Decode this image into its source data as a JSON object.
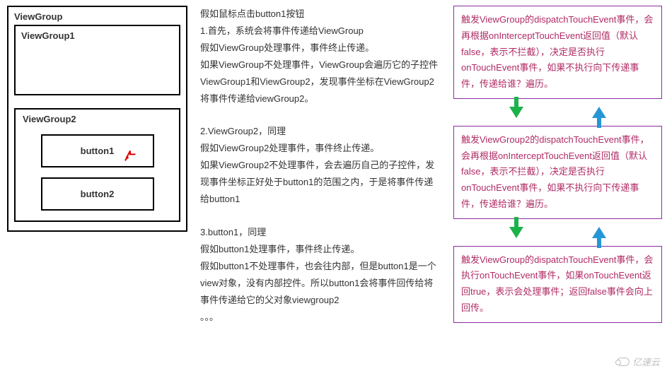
{
  "left": {
    "viewgroup_label": "ViewGroup",
    "viewgroup1_label": "ViewGroup1",
    "viewgroup2_label": "ViewGroup2",
    "button1_label": "button1",
    "button2_label": "button2"
  },
  "middle": {
    "p1_l1": "假如鼠标点击button1按钮",
    "p1_l2": "1.首先，系统会将事件传递给ViewGroup",
    "p1_l3": "假如ViewGroup处理事件，事件终止传递。",
    "p1_l4": "如果ViewGroup不处理事件，ViewGroup会遍历它的子控件ViewGroup1和ViewGroup2，发现事件坐标在ViewGroup2将事件传递给viewGroup2。",
    "p2_l1": "2.ViewGroup2，同理",
    "p2_l2": "假如ViewGroup2处理事件，事件终止传递。",
    "p2_l3": "如果ViewGroup2不处理事件，会去遍历自己的子控件，发现事件坐标正好处于button1的范围之内，于是将事件传递给button1",
    "p3_l1": "3.button1，同理",
    "p3_l2": "假如button1处理事件，事件终止传递。",
    "p3_l3": "假如button1不处理事件，也会往内部，但是button1是一个view对象，没有内部控件。所以button1会将事件回传给将事件传递给它的父对象viewgroup2",
    "p3_l4": "。。。"
  },
  "right": {
    "box1": "触发ViewGroup的dispatchTouchEvent事件，会再根据onInterceptTouchEvent返回值（默认false，表示不拦截），决定是否执行onTouchEvent事件，如果不执行向下传递事件，传递给谁？遍历。",
    "box2": "触发ViewGroup2的dispatchTouchEvent事件，会再根据onInterceptTouchEvent返回值（默认false，表示不拦截），决定是否执行onTouchEvent事件，如果不执行向下传递事件，传递给谁？遍历。",
    "box3": "触发ViewGroup的dispatchTouchEvent事件，会执行onTouchEvent事件，如果onTouchEvent返回true，表示会处理事件；返回false事件会向上回传。"
  },
  "watermark": "亿速云"
}
